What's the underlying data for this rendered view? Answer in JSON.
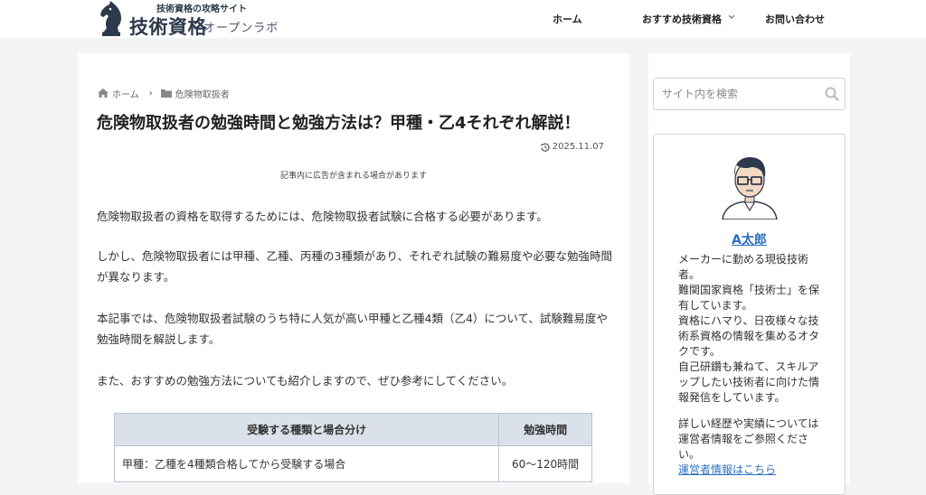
{
  "header": {
    "logo_tagline": "技術資格の攻略サイト",
    "logo_title": "技術資格",
    "logo_sub": "オープンラボ",
    "nav": [
      {
        "label": "ホーム"
      },
      {
        "label": "おすすめ技術資格",
        "has_dropdown": true
      },
      {
        "label": "お問い合わせ"
      }
    ]
  },
  "breadcrumb": {
    "home": "ホーム",
    "category": "危険物取扱者"
  },
  "article": {
    "title": "危険物取扱者の勉強時間と勉強方法は？甲種・乙4それぞれ解説！",
    "date": "2025.11.07",
    "ad_note": "記事内に広告が含まれる場合があります",
    "paragraphs": [
      "危険物取扱者の資格を取得するためには、危険物取扱者試験に合格する必要があります。",
      "しかし、危険物取扱者には甲種、乙種、丙種の3種類があり、それぞれ試験の難易度や必要な勉強時間が異なります。",
      "本記事では、危険物取扱者試験のうち特に人気が高い甲種と乙種4類（乙4）について、試験難易度や勉強時間を解説します。",
      "また、おすすめの勉強方法についても紹介しますので、ぜひ参考にしてください。"
    ],
    "table": {
      "headers": [
        "受験する種類と場合分け",
        "勉強時間"
      ],
      "rows": [
        [
          "甲種：乙種を4種類合格してから受験する場合",
          "60〜120時間"
        ]
      ]
    }
  },
  "sidebar": {
    "search_placeholder": "サイト内を検索",
    "profile": {
      "name": "A太郎",
      "bio": [
        "メーカーに勤める現役技術者。",
        "難関国家資格「技術士」を保有しています。",
        "資格にハマり、日夜様々な技術系資格の情報を集めるオタクです。",
        "自己研鑽も兼ねて、スキルアップしたい技術者に向けた情報発信をしています。",
        "詳しい経歴や実績については運営者情報をご参照ください。"
      ],
      "link": "運営者情報はこちら"
    }
  },
  "colors": {
    "brand": "#2d3a4b",
    "link": "#2a6fbd",
    "table_header_bg": "#dbe1ea",
    "page_bg": "#f3f4f6"
  }
}
